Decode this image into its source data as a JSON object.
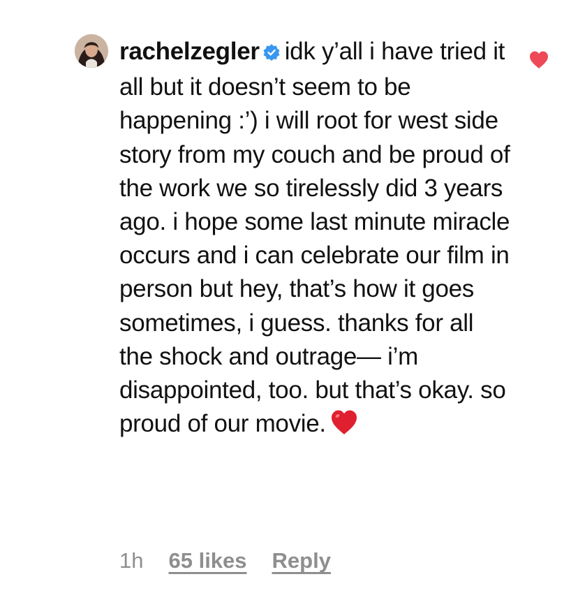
{
  "comment": {
    "username": "rachelzegler",
    "verified": true,
    "text": "idk y’all i have tried it all but it doesn’t seem to be happening :’) i will root for west side story from my couch and be proud of the work we so tirelessly did 3 years ago. i hope some last minute miracle occurs and i can celebrate our film in person but hey, that’s how it goes sometimes, i guess. thanks for all the shock and outrage— i’m disappointed, too. but that’s okay. so proud of our movie.",
    "trailing_emoji": "red-heart",
    "timestamp": "1h",
    "likes_label": "65 likes",
    "reply_label": "Reply",
    "liked": true
  },
  "colors": {
    "text": "#111111",
    "meta": "#8e8e8e",
    "verified_badge": "#3897f0",
    "like_heart": "#ed4956",
    "emoji_heart": "#e0202f"
  },
  "icons": {
    "verified": "verified-badge-icon",
    "like": "heart-icon",
    "emoji": "red-heart-emoji-icon"
  }
}
